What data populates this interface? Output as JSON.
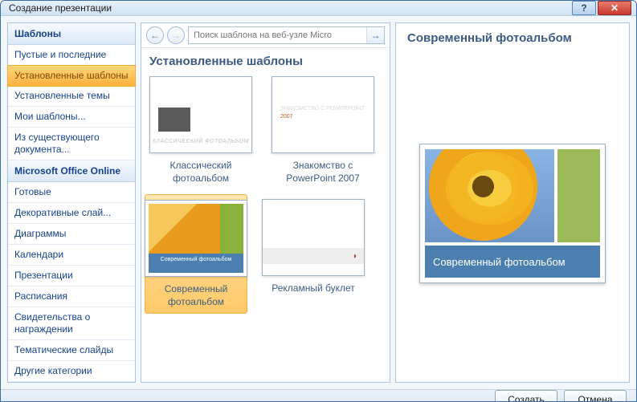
{
  "window": {
    "title": "Создание презентации"
  },
  "sidebar": {
    "header1": "Шаблоны",
    "items1": [
      "Пустые и последние",
      "Установленные шаблоны",
      "Установленные темы",
      "Мои шаблоны...",
      "Из существующего документа..."
    ],
    "selected1_index": 1,
    "header2": "Microsoft Office Online",
    "items2": [
      "Готовые",
      "Декоративные слай...",
      "Диаграммы",
      "Календари",
      "Презентации",
      "Расписания",
      "Свидетельства о награждении",
      "Тематические слайды",
      "Другие категории"
    ]
  },
  "nav": {
    "search_placeholder": "Поиск шаблона на веб-узле Micro"
  },
  "section": {
    "title": "Установленные шаблоны"
  },
  "templates": [
    {
      "label": "Классический фотоальбом",
      "thumb_caption": "КЛАССИЧЕСКИЙ ФОТОАЛЬБОМ"
    },
    {
      "label": "Знакомство с PowerPoint 2007",
      "t1": "ЗНАКОМСТВО С POWERPOINT",
      "t2": "2007"
    },
    {
      "label": "Современный фотоальбом",
      "caption": "Современный фотоальбом"
    },
    {
      "label": "Рекламный буклет"
    }
  ],
  "selected_template_index": 2,
  "preview": {
    "title": "Современный фотоальбом",
    "caption": "Современный фотоальбом"
  },
  "footer": {
    "create": "Создать",
    "cancel": "Отмена"
  }
}
